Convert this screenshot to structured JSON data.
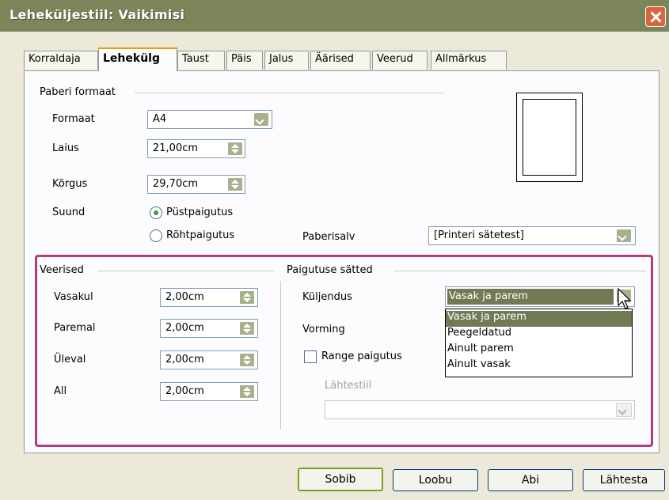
{
  "window": {
    "title": "Leheküljestiil: Vaikimisi"
  },
  "tabs": [
    {
      "label": "Korraldaja"
    },
    {
      "label": "Lehekülg"
    },
    {
      "label": "Taust"
    },
    {
      "label": "Päis"
    },
    {
      "label": "Jalus"
    },
    {
      "label": "Äärised"
    },
    {
      "label": "Veerud"
    },
    {
      "label": "Allmärkus"
    }
  ],
  "paper_format": {
    "section_label": "Paberi formaat",
    "format_label": "Formaat",
    "format_value": "A4",
    "width_label": "Laius",
    "width_value": "21,00cm",
    "height_label": "Kõrgus",
    "height_value": "29,70cm",
    "orientation_label": "Suund",
    "portrait_label": "Püstpaigutus",
    "landscape_label": "Rõhtpaigutus",
    "tray_label": "Paberisalv",
    "tray_value": "[Printeri sätetest]"
  },
  "margins": {
    "section_label": "Veerised",
    "left_label": "Vasakul",
    "left_value": "2,00cm",
    "right_label": "Paremal",
    "right_value": "2,00cm",
    "top_label": "Üleval",
    "top_value": "2,00cm",
    "bottom_label": "All",
    "bottom_value": "2,00cm"
  },
  "layout": {
    "section_label": "Paigutuse sätted",
    "alignment_label": "Küljendus",
    "alignment_value": "Vasak ja parem",
    "options": [
      "Vasak ja parem",
      "Peegeldatud",
      "Ainult parem",
      "Ainult vasak"
    ],
    "format_label": "Vorming",
    "register_label": "Range paigutus",
    "ref_style_label": "Lähtestiil",
    "ref_style_value": ""
  },
  "buttons": {
    "ok": "Sobib",
    "cancel": "Loobu",
    "help": "Abi",
    "reset": "Lähtesta"
  },
  "colors": {
    "titlebar": "#7b8559",
    "highlight": "#b23a80",
    "selection": "#717a53"
  }
}
